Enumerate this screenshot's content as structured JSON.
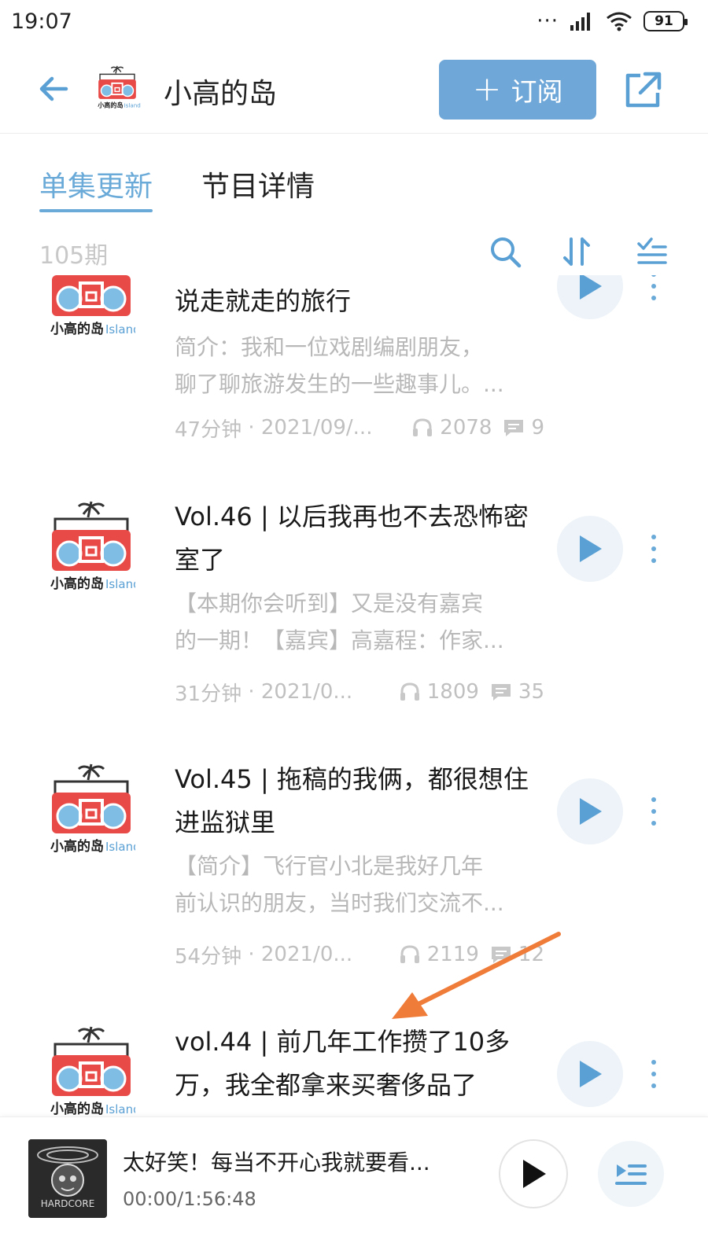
{
  "status_bar": {
    "time": "19:07",
    "battery": "91",
    "dots": "···"
  },
  "header": {
    "title": "小高的岛",
    "subscribe_label": "订阅",
    "subscribe_plus": "+"
  },
  "tabs": [
    {
      "label": "单集更新",
      "active": true
    },
    {
      "label": "节目详情",
      "active": false
    }
  ],
  "toolbar": {
    "episode_count": "105期"
  },
  "episodes": [
    {
      "title": "说走就走的旅行",
      "desc_lines": [
        "简介：我和一位戏剧编剧朋友，",
        "聊了聊旅游发生的一些趣事儿。..."
      ],
      "duration": "47分钟",
      "date": "2021/09/...",
      "plays": "2078",
      "comments": "9"
    },
    {
      "title": "Vol.46 | 以后我再也不去恐怖密室了",
      "desc_lines": [
        "【本期你会听到】又是没有嘉宾",
        "的一期！【嘉宾】高嘉程：作家..."
      ],
      "duration": "31分钟",
      "date": "2021/0...",
      "plays": "1809",
      "comments": "35"
    },
    {
      "title": "Vol.45 | 拖稿的我俩，都很想住进监狱里",
      "desc_lines": [
        "【简介】飞行官小北是我好几年",
        "前认识的朋友，当时我们交流不..."
      ],
      "duration": "54分钟",
      "date": "2021/0...",
      "plays": "2119",
      "comments": "12"
    },
    {
      "title": "vol.44 | 前几年工作攒了10多万，我全都拿来买奢侈品了",
      "desc_lines": [],
      "duration": "",
      "date": "",
      "plays": "",
      "comments": ""
    }
  ],
  "now_playing": {
    "title": "太好笑！每当不开心我就要看...",
    "time": "00:00/1:56:48",
    "cover_text": "HARDCORE"
  },
  "icons": {
    "back": "back-arrow-icon",
    "share": "share-icon",
    "search": "search-icon",
    "sort": "sort-icon",
    "filter": "filter-list-icon",
    "play": "play-icon",
    "more": "more-vertical-icon",
    "headphones": "headphones-icon",
    "comment": "comment-icon",
    "queue": "playlist-icon"
  },
  "colors": {
    "accent": "#6aaad8",
    "subscribe_bg": "#6fa8d8",
    "logo_red": "#e84a48",
    "logo_blue": "#7fbde5",
    "annotation": "#f07c3a"
  }
}
